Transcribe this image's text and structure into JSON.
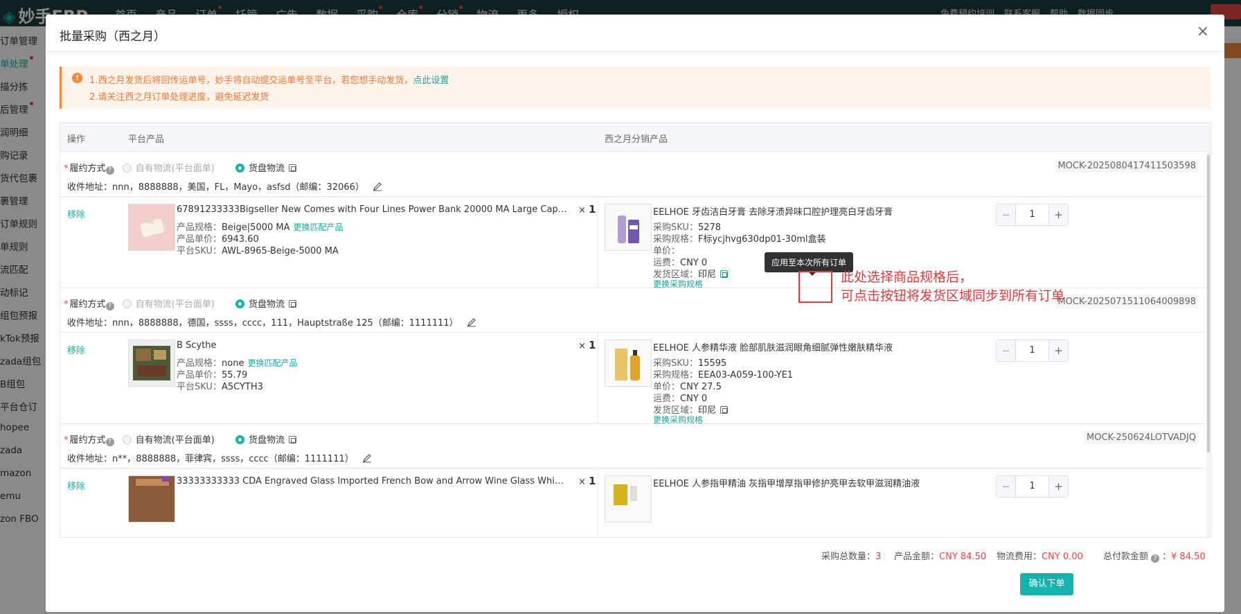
{
  "app": {
    "logo_text": "妙手ERP",
    "nav": [
      "首页",
      "产品",
      "订单",
      "托管",
      "广告",
      "数据",
      "采购",
      "仓库",
      "分销",
      "物流",
      "更多",
      "授权"
    ],
    "nav_right": [
      "免费预约培训",
      "联系客服",
      "帮助",
      "数据同步"
    ]
  },
  "sidebar": {
    "items": [
      "订单管理",
      "单处理",
      "描分拣",
      "后管理",
      "润明细",
      "购记录",
      "货代包裹",
      "裹管理",
      "订单规则",
      "单规则",
      "流匹配",
      "动标记",
      "组包预报",
      "kTok预报",
      "zada组包",
      "B组包",
      "平台仓订",
      "hopee",
      "zada",
      "mazon",
      "emu",
      "zon FBO"
    ]
  },
  "modal": {
    "title": "批量采购（西之月）",
    "close": "×",
    "alert": {
      "line1": "1.西之月发货后将回传运单号，妙手将自动提交运单号至平台，若您想手动发货，",
      "line1_link": "点此设置",
      "line2": "2.请关注西之月订单处理进度，避免延迟发货"
    },
    "table": {
      "col_action": "操作",
      "col_platform": "平台产品",
      "col_supplier": "西之月分销产品"
    },
    "labels": {
      "fulfillment": "履约方式",
      "self_logistics": "自有物流(平台面单)",
      "stock_logistics": "货盘物流",
      "address_prefix": "收件地址：",
      "remove": "移除",
      "spec": "产品规格：",
      "price": "产品单价：",
      "platform_sku": "平台SKU：",
      "change_match": "更换匹配产品",
      "purchase_sku": "采购SKU：",
      "purchase_spec": "采购规格：",
      "unit_price": "单价：",
      "shipping": "运费：",
      "ship_region": "发货区域：",
      "change_spec": "更换采购规格",
      "qty_prefix": "× "
    },
    "orders": [
      {
        "order_id": "MOCK-2025080417411503598",
        "address": "nnn，8888888，美国，FL，Mayo，asfsd（邮编：32066）",
        "product_title": "67891233333Bigseller New Comes with Four Lines Power Bank 20000 MA Large Capacity Digital Displa...",
        "spec": "Beige|5000 MA",
        "price": "6943.60",
        "platform_sku": "AWL-8965-Beige-5000 MA",
        "qty": "1",
        "supplier_title": "EELHOE 牙齿洁白牙膏 去除牙渍异味口腔护理亮白牙齿牙膏",
        "purchase_sku": "5278",
        "purchase_spec": "F标ycjhvg630dp01-30ml盒装",
        "unit_price": "",
        "shipping": "CNY 0",
        "ship_region": "印尼",
        "stepper_value": "1"
      },
      {
        "order_id": "MOCK-2025071511064009898",
        "address": "nnn，8888888，德国，ssss，cccc，111，Hauptstraße 125（邮编：1111111）",
        "product_title": "B Scythe",
        "spec": "none",
        "price": "55.79",
        "platform_sku": "A5CYTH3",
        "qty": "1",
        "supplier_title": "EELHOE 人参精华液 脸部肌肤滋润眼角细腻弹性嫩肤精华液",
        "purchase_sku": "15595",
        "purchase_spec": "EEA03-A059-100-YE1",
        "unit_price": "CNY 27.5",
        "shipping": "CNY 0",
        "ship_region": "印尼",
        "stepper_value": "1"
      },
      {
        "order_id": "MOCK-250624LOTVADJQ",
        "address": "n**，8888888，菲律宾，ssss，cccc（邮编：1111111）",
        "product_title": "33333333333   CDA Engraved Glass Imported French Bow and Arrow Wine Glass Whiskey Glass ...",
        "qty": "1",
        "supplier_title": "EELHOE 人参指甲精油 灰指甲增厚指甲修护亮甲去软甲滋润精油液",
        "stepper_value": "1"
      }
    ],
    "tooltip": "应用至本次所有订单",
    "annotation": {
      "line1": "此处选择商品规格后，",
      "line2": "可点击按钮将发货区域同步到所有订单"
    },
    "footer": {
      "total_qty_label": "采购总数量：",
      "total_qty": "3",
      "product_amount_label": "产品金额：",
      "product_amount": "CNY 84.50",
      "shipping_label": "物流费用：",
      "shipping_fee": "CNY 0.00",
      "total_label": "总付款金额",
      "total_amount": "¥ 84.50",
      "confirm": "确认下单"
    }
  }
}
